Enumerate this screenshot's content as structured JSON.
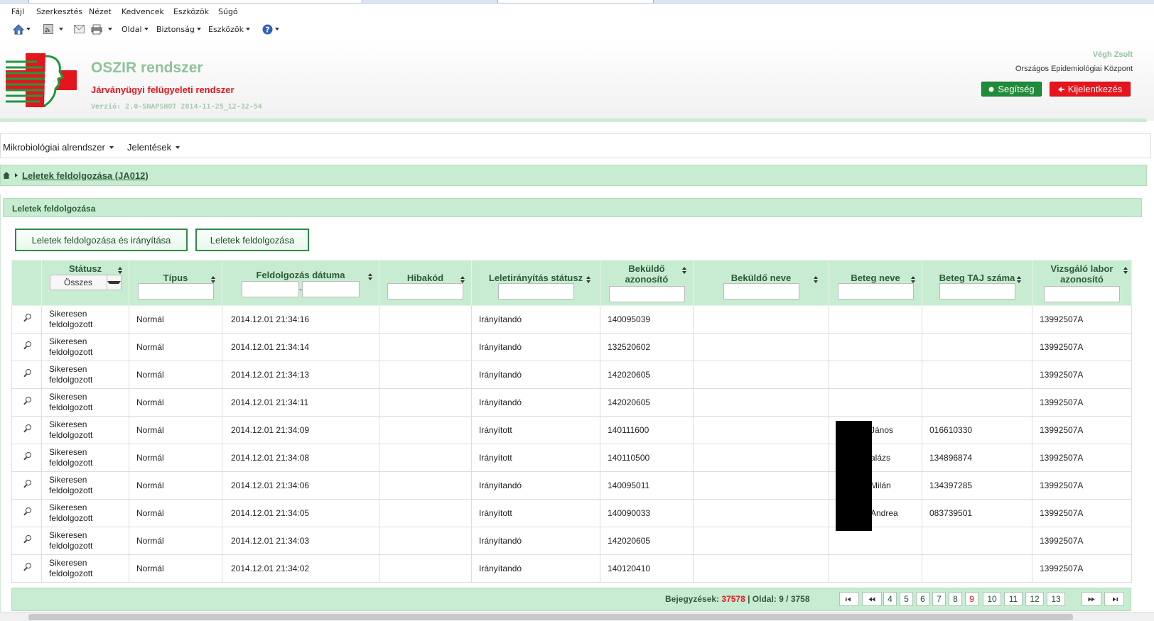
{
  "browser": {
    "menu": [
      "Fájl",
      "Szerkesztés",
      "Nézet",
      "Kedvencek",
      "Eszközök",
      "Súgó"
    ],
    "cmd_page": "Oldal",
    "cmd_security": "Biztonság",
    "cmd_tools": "Eszközök"
  },
  "header": {
    "title": "OSZIR rendszer",
    "subtitle": "Járványügyi felügyeleti rendszer",
    "version": "Verzió: 2.0-SNAPSHOT 2014-11-25_12-32-54",
    "user": "Végh Zsolt",
    "org": "Országos Epidemiológiai Központ",
    "help_label": "Segítség",
    "logout_label": "Kijelentkezés"
  },
  "nav": {
    "items": [
      "Mikrobiológiai alrendszer",
      "Jelentések"
    ]
  },
  "breadcrumb": "Leletek feldolgozása (JA012)",
  "panel": {
    "title": "Leletek feldolgozása",
    "btn_process_route": "Leletek feldolgozása és irányítása",
    "btn_process": "Leletek feldolgozása"
  },
  "grid": {
    "columns": [
      {
        "key": "status",
        "label": "Státusz"
      },
      {
        "key": "type",
        "label": "Típus"
      },
      {
        "key": "date",
        "label": "Feldolgozás dátuma"
      },
      {
        "key": "error",
        "label": "Hibakód"
      },
      {
        "key": "route",
        "label": "Leletirányítás státusz"
      },
      {
        "key": "sender_id",
        "label": "Beküldő azonosító"
      },
      {
        "key": "sender_name",
        "label": "Beküldő neve"
      },
      {
        "key": "patient",
        "label": "Beteg neve"
      },
      {
        "key": "taj",
        "label": "Beteg TAJ száma"
      },
      {
        "key": "lab",
        "label": "Vizsgáló labor azonosító"
      }
    ],
    "status_filter": "Összes",
    "date_separator": "-",
    "rows": [
      {
        "status": "Sikeresen feldolgozott",
        "type": "Normál",
        "date": "2014.12.01 21:34:16",
        "error": "",
        "route": "Irányítandó",
        "sender_id": "140095039",
        "sender_name": "",
        "patient": "",
        "taj": "",
        "lab": "13992507A"
      },
      {
        "status": "Sikeresen feldolgozott",
        "type": "Normál",
        "date": "2014.12.01 21:34:14",
        "error": "",
        "route": "Irányítandó",
        "sender_id": "132520602",
        "sender_name": "",
        "patient": "",
        "taj": "",
        "lab": "13992507A"
      },
      {
        "status": "Sikeresen feldolgozott",
        "type": "Normál",
        "date": "2014.12.01 21:34:13",
        "error": "",
        "route": "Irányítandó",
        "sender_id": "142020605",
        "sender_name": "",
        "patient": "",
        "taj": "",
        "lab": "13992507A"
      },
      {
        "status": "Sikeresen feldolgozott",
        "type": "Normál",
        "date": "2014.12.01 21:34:11",
        "error": "",
        "route": "Irányítandó",
        "sender_id": "142020605",
        "sender_name": "",
        "patient": "",
        "taj": "",
        "lab": "13992507A"
      },
      {
        "status": "Sikeresen feldolgozott",
        "type": "Normál",
        "date": "2014.12.01 21:34:09",
        "error": "",
        "route": "Irányított",
        "sender_id": "140111600",
        "sender_name": "",
        "patient": "János",
        "taj": "016610330",
        "lab": "13992507A"
      },
      {
        "status": "Sikeresen feldolgozott",
        "type": "Normál",
        "date": "2014.12.01 21:34:08",
        "error": "",
        "route": "Irányított",
        "sender_id": "140110500",
        "sender_name": "",
        "patient": "alázs",
        "taj": "134896874",
        "lab": "13992507A"
      },
      {
        "status": "Sikeresen feldolgozott",
        "type": "Normál",
        "date": "2014.12.01 21:34:06",
        "error": "",
        "route": "Irányítandó",
        "sender_id": "140095011",
        "sender_name": "",
        "patient": "Milán",
        "taj": "134397285",
        "lab": "13992507A"
      },
      {
        "status": "Sikeresen feldolgozott",
        "type": "Normál",
        "date": "2014.12.01 21:34:05",
        "error": "",
        "route": "Irányított",
        "sender_id": "140090033",
        "sender_name": "",
        "patient": "Andrea",
        "taj": "083739501",
        "lab": "13992507A"
      },
      {
        "status": "Sikeresen feldolgozott",
        "type": "Normál",
        "date": "2014.12.01 21:34:03",
        "error": "",
        "route": "Irányítandó",
        "sender_id": "142020605",
        "sender_name": "",
        "patient": "",
        "taj": "",
        "lab": "13992507A"
      },
      {
        "status": "Sikeresen feldolgozott",
        "type": "Normál",
        "date": "2014.12.01 21:34:02",
        "error": "",
        "route": "Irányítandó",
        "sender_id": "140120410",
        "sender_name": "",
        "patient": "",
        "taj": "",
        "lab": "13992507A"
      }
    ]
  },
  "pager": {
    "records_label": "Bejegyzések:",
    "records": "37578",
    "page_label": "| Oldal: 9 / 3758",
    "pages": [
      "4",
      "5",
      "6",
      "7",
      "8",
      "9",
      "10",
      "11",
      "12",
      "13"
    ],
    "current": "9"
  },
  "colors": {
    "accent_green": "#c8ecd2",
    "brand_red": "#e3161e",
    "help_green": "#1f8c3a"
  }
}
